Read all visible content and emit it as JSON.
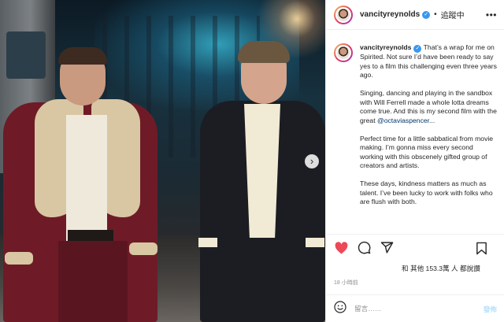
{
  "header": {
    "username": "vancityreynolds",
    "separator": "•",
    "follow_status": "追蹤中",
    "more_icon": "more-horizontal-icon"
  },
  "caption": {
    "username": "vancityreynolds",
    "para1": "That’s a wrap for me on Spirited. Not sure I’d have been ready to say yes to a film this challenging even three years ago.",
    "para2_text": "Singing, dancing and playing in the sandbox with Will Ferrell made a whole lotta dreams come true. And this is my second film with the great ",
    "para2_mention": "@octaviaspencer",
    "para2_end": "...",
    "para3": "Perfect time for a little sabbatical from movie making. I’m gonna miss every second working with this obscenely gifted group of creators and artists.",
    "para4": "These days, kindness matters as much as talent. I’ve been lucky to work with folks who are flush with both."
  },
  "media": {
    "next_glyph": "›"
  },
  "actions": {
    "icons": [
      "heart-icon",
      "comment-icon",
      "share-icon",
      "bookmark-icon"
    ],
    "liked": true,
    "like_color": "#ed4956"
  },
  "likes_text": "和 其他 153.3萬 人 都說讚",
  "time_text": "18 小時前",
  "comment": {
    "placeholder": "留言……",
    "post_label": "發佈"
  },
  "colors": {
    "verified": "#3897f0",
    "mention": "#00376b",
    "post_button": "#b2dffc"
  }
}
